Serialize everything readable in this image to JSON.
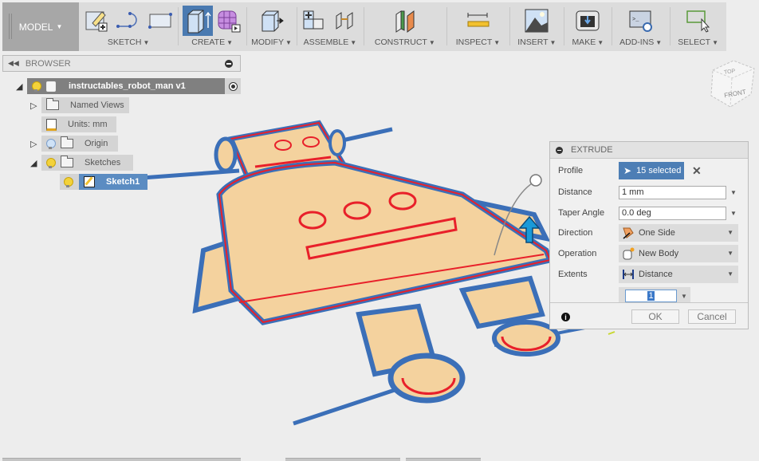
{
  "toolbar": {
    "workspace": "MODEL",
    "groups": [
      {
        "label": "SKETCH",
        "icons": [
          "create-sketch-icon",
          "line-arc-icon",
          "rectangle-icon"
        ]
      },
      {
        "label": "CREATE",
        "icons": [
          "extrude-icon",
          "form-box-icon"
        ]
      },
      {
        "label": "MODIFY",
        "icons": [
          "press-pull-icon"
        ]
      },
      {
        "label": "ASSEMBLE",
        "icons": [
          "new-component-icon",
          "joint-icon"
        ]
      },
      {
        "label": "CONSTRUCT",
        "icons": [
          "construct-plane-icon"
        ]
      },
      {
        "label": "INSPECT",
        "icons": [
          "measure-ruler-icon"
        ]
      },
      {
        "label": "INSERT",
        "icons": [
          "insert-image-icon"
        ]
      },
      {
        "label": "MAKE",
        "icons": [
          "3d-print-icon"
        ]
      },
      {
        "label": "ADD-INS",
        "icons": [
          "scripts-addins-icon"
        ]
      },
      {
        "label": "SELECT",
        "icons": [
          "window-select-icon"
        ]
      }
    ]
  },
  "browser": {
    "title": "BROWSER",
    "root": "instructables_robot_man v1",
    "items": [
      {
        "label": "Named Views"
      },
      {
        "label": "Units: mm"
      },
      {
        "label": "Origin"
      },
      {
        "label": "Sketches"
      },
      {
        "label": "Sketch1"
      }
    ]
  },
  "viewcube": {
    "top": "TOP",
    "front": "FRONT"
  },
  "extrude": {
    "title": "EXTRUDE",
    "profile_label": "Profile",
    "profile_value": "15 selected",
    "distance_label": "Distance",
    "distance_value": "1 mm",
    "taper_label": "Taper Angle",
    "taper_value": "0.0 deg",
    "direction_label": "Direction",
    "direction_value": "One Side",
    "operation_label": "Operation",
    "operation_value": "New Body",
    "extents_label": "Extents",
    "extents_value": "Distance",
    "inline_value": "1",
    "ok": "OK",
    "cancel": "Cancel"
  },
  "colors": {
    "accent": "#4d7eb5",
    "sketch_fill": "#f4d29e",
    "profile_edge": "#e8202a",
    "body_blue": "#3b6fb8"
  }
}
